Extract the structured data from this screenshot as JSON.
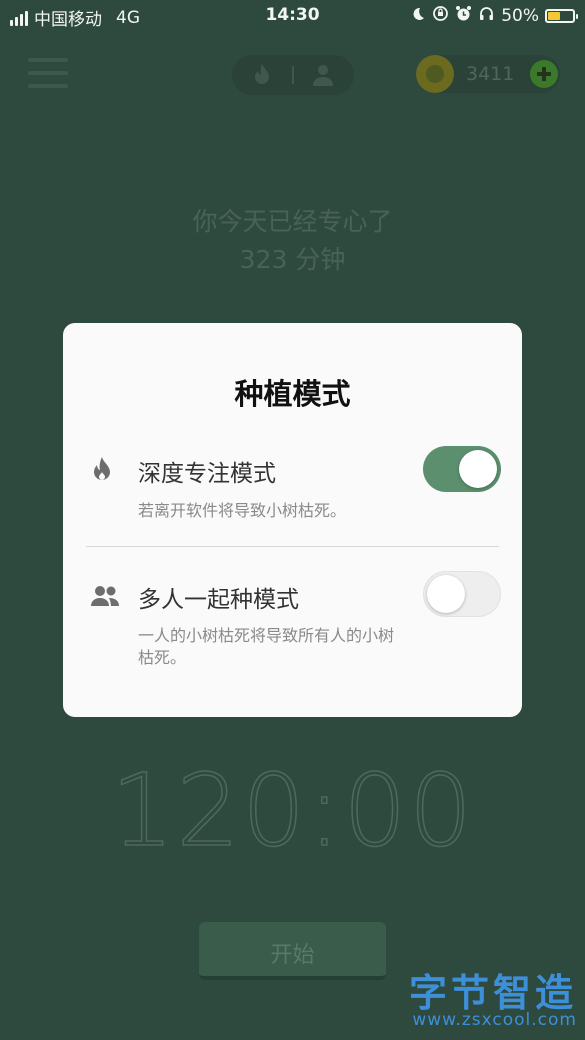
{
  "status_bar": {
    "carrier": "中国移动",
    "network": "4G",
    "time": "14:30",
    "battery": "50%",
    "battery_level": 0.5
  },
  "top_bar": {
    "coin_count": "3411"
  },
  "focus_summary": {
    "line1": "你今天已经专心了",
    "line2": "323 分钟"
  },
  "dialog": {
    "title": "种植模式",
    "deep_focus": {
      "title": "深度专注模式",
      "description": "若离开软件将导致小树枯死。",
      "enabled": true
    },
    "multiplayer": {
      "title": "多人一起种模式",
      "description": "一人的小树枯死将导致所有人的小树枯死。",
      "enabled": false
    }
  },
  "timer": {
    "display": "120:00"
  },
  "start_button": {
    "label": "开始"
  },
  "watermark": {
    "title": "字节智造",
    "url": "www.zsxcool.com"
  },
  "colors": {
    "background": "#2e4a3e",
    "accent_green": "#5b8f6e",
    "watermark_blue": "#3c8fd8"
  }
}
